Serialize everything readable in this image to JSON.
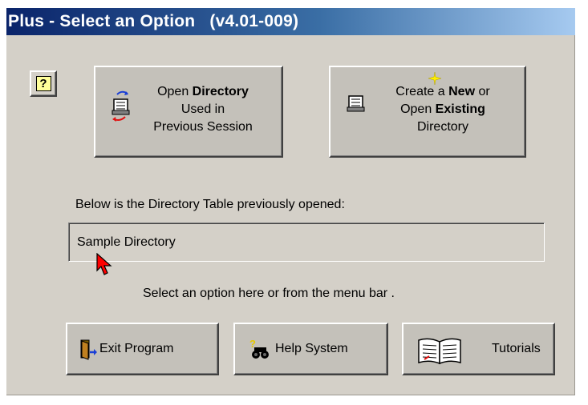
{
  "window": {
    "title": "Plus - Select an Option   (v4.01-009)"
  },
  "help_icon": {
    "glyph": "?",
    "icon": "question-mark-icon"
  },
  "open_previous": {
    "line1_pre": "Open ",
    "line1_bold": "Directory",
    "line2": "Used in",
    "line3": "Previous Session",
    "icon": "open-directory-icon"
  },
  "create_new": {
    "line1_pre": "Create a ",
    "line1_bold": "New",
    "line1_post": " or",
    "line2_pre": "Open ",
    "line2_bold": "Existing",
    "line3": "Directory",
    "icon": "new-directory-icon"
  },
  "directory_label": "Below is the Directory Table previously opened:",
  "directory_value": "Sample Directory",
  "hint": "Select an option here or from the menu bar .",
  "buttons": {
    "exit": {
      "label": "Exit Program",
      "icon": "exit-door-icon"
    },
    "help": {
      "label": "Help System",
      "icon": "binoculars-icon"
    },
    "tutorials": {
      "label": "Tutorials",
      "icon": "book-icon"
    }
  },
  "colors": {
    "title_start": "#0a246a",
    "title_end": "#a6caf0",
    "face": "#d4d0c8",
    "button_face": "#c4c1ba",
    "cursor": "#ff0000"
  }
}
